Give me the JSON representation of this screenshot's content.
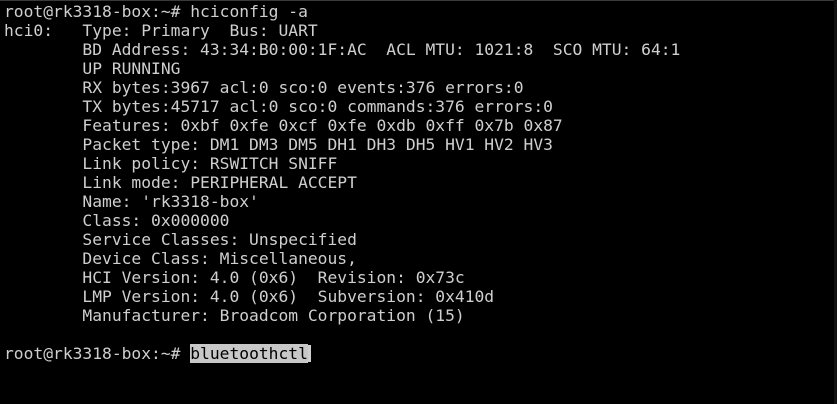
{
  "terminal": {
    "prompt1": "root@rk3318-box:~# ",
    "command1": "hciconfig -a",
    "output": [
      "hci0:   Type: Primary  Bus: UART",
      "        BD Address: 43:34:B0:00:1F:AC  ACL MTU: 1021:8  SCO MTU: 64:1",
      "        UP RUNNING",
      "        RX bytes:3967 acl:0 sco:0 events:376 errors:0",
      "        TX bytes:45717 acl:0 sco:0 commands:376 errors:0",
      "        Features: 0xbf 0xfe 0xcf 0xfe 0xdb 0xff 0x7b 0x87",
      "        Packet type: DM1 DM3 DM5 DH1 DH3 DH5 HV1 HV2 HV3",
      "        Link policy: RSWITCH SNIFF",
      "        Link mode: PERIPHERAL ACCEPT",
      "        Name: 'rk3318-box'",
      "        Class: 0x000000",
      "        Service Classes: Unspecified",
      "        Device Class: Miscellaneous,",
      "        HCI Version: 4.0 (0x6)  Revision: 0x73c",
      "        LMP Version: 4.0 (0x6)  Subversion: 0x410d",
      "        Manufacturer: Broadcom Corporation (15)"
    ],
    "prompt2": "root@rk3318-box:~# ",
    "command2": "bluetoothctl"
  },
  "colors": {
    "background": "#000000",
    "text": "#cfcfcf",
    "selection": "#c8c8c8"
  }
}
